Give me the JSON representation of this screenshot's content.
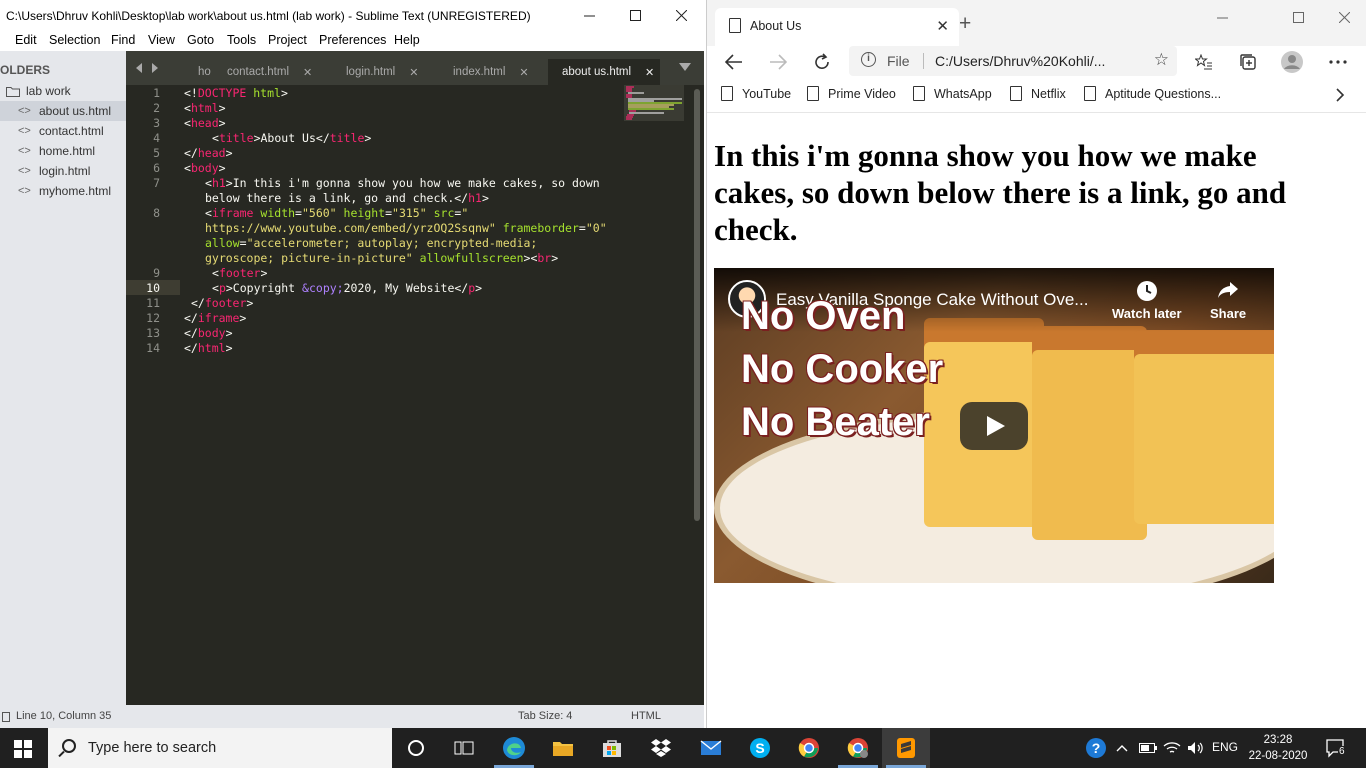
{
  "sublime": {
    "title": "C:\\Users\\Dhruv Kohli\\Desktop\\lab work\\about us.html (lab work) - Sublime Text (UNREGISTERED)",
    "menu": [
      "Edit",
      "Selection",
      "Find",
      "View",
      "Goto",
      "Tools",
      "Project",
      "Preferences",
      "Help"
    ],
    "sidebar": {
      "header": "OLDERS",
      "folder": "lab work",
      "files": [
        "about us.html",
        "contact.html",
        "home.html",
        "login.html",
        "myhome.html"
      ]
    },
    "tabs": [
      "ho",
      "contact.html",
      "login.html",
      "index.html",
      "about us.html"
    ],
    "line_numbers": [
      "1",
      "2",
      "3",
      "4",
      "5",
      "6",
      "7",
      "8",
      "9",
      "10",
      "11",
      "12",
      "13",
      "14"
    ],
    "code": {
      "l1_a": "<!",
      "l1_b": "DOCTYPE",
      "l1_c": " html",
      "l1_d": ">",
      "html": "html",
      "head": "head",
      "title": "title",
      "title_text": "About Us",
      "body": "body",
      "h1": "h1",
      "h1_text_1": "In this i'm gonna show you how we make cakes, so down",
      "h1_text_2": "below there is a link, go and check.",
      "iframe": "iframe",
      "attr_width": "width",
      "val_width": "\"560\"",
      "attr_height": "height",
      "val_height": "\"315\"",
      "attr_src": "src",
      "val_src_1": "\"",
      "val_src_2": "https://www.youtube.com/embed/yrzOQ2Ssqnw\"",
      "attr_frameborder": "frameborder",
      "val_frameborder": "\"0\"",
      "attr_allow": "allow",
      "val_allow_1": "\"accelerometer; autoplay; encrypted-media;",
      "val_allow_2": "gyroscope; picture-in-picture\"",
      "attr_allowfullscreen": "allowfullscreen",
      "br": "br",
      "footer": "footer",
      "p": "p",
      "copy_entity": "&copy;",
      "copy_text": "2020, My Website"
    },
    "status": {
      "position": "Line 10, Column 35",
      "tab_size": "Tab Size: 4",
      "syntax": "HTML"
    }
  },
  "edge": {
    "tab_title": "About Us",
    "url_scheme": "File",
    "url": "C:/Users/Dhruv%20Kohli/...",
    "bookmarks": [
      "YouTube",
      "Prime Video",
      "WhatsApp",
      "Netflix",
      "Aptitude Questions..."
    ],
    "heading": "In this i'm gonna show you how we make cakes, so down below there is a link, go and check.",
    "video": {
      "title": "Easy Vanilla Sponge Cake Without Ove...",
      "watch_later": "Watch later",
      "share": "Share",
      "overlay_lines": [
        "No Oven",
        "No Cooker",
        "No Beater"
      ]
    }
  },
  "taskbar": {
    "search_placeholder": "Type here to search",
    "language": "ENG",
    "time": "23:28",
    "date": "22-08-2020",
    "notifications": "6"
  },
  "colors": {
    "editor_bg": "#272822",
    "tag": "#f92672",
    "attr": "#a6e22e",
    "string": "#e6db74",
    "entity": "#ae81ff"
  }
}
